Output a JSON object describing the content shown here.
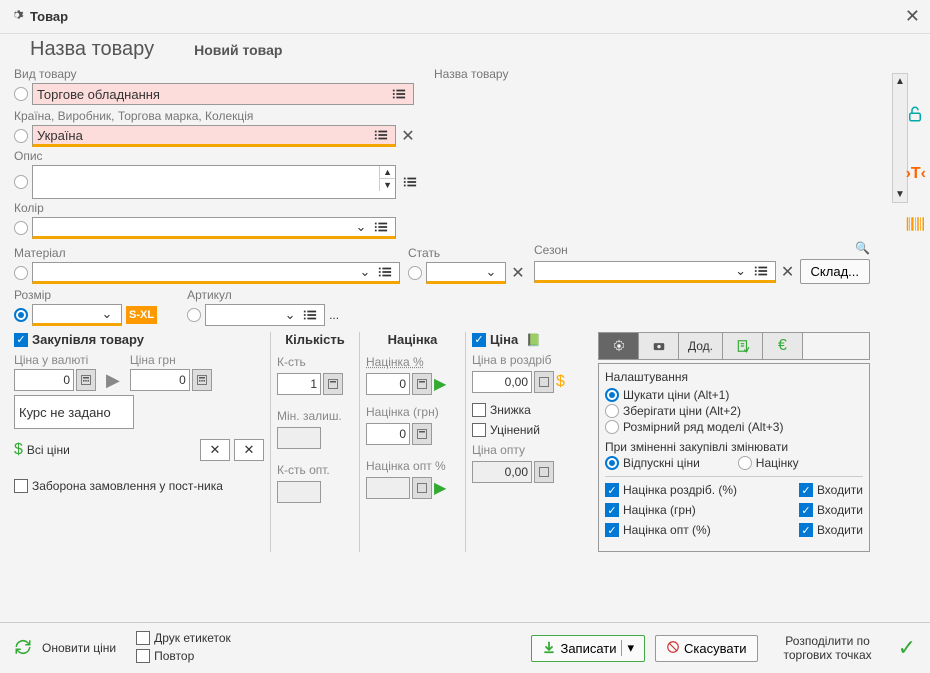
{
  "window": {
    "title": "Товар"
  },
  "header": {
    "name_label": "Назва товару",
    "new_label": "Новий товар"
  },
  "fields": {
    "type_label": "Вид товару",
    "type_value": "Торгове обладнання",
    "name2_label": "Назва товару",
    "country_label": "Країна, Виробник, Торгова марка, Колекція",
    "country_value": "Україна",
    "desc_label": "Опис",
    "color_label": "Колір",
    "material_label": "Матеріал",
    "gender_label": "Стать",
    "season_label": "Сезон",
    "warehouse_btn": "Склад...",
    "size_label": "Розмір",
    "sxl": "S-XL",
    "article_label": "Артикул",
    "dots": "..."
  },
  "purchase": {
    "title": "Закупівля товару",
    "price_currency": "Ціна у валюті",
    "price_grn": "Ціна грн",
    "val0": "0",
    "rate_msg": "Курс не задано",
    "all_prices": "Всі ціни",
    "forbid": "Заборона замовлення у пост-ника"
  },
  "qty": {
    "title": "Кількість",
    "count": "К-сть",
    "count_val": "1",
    "min": "Мін. залиш.",
    "wholesale": "К-сть опт."
  },
  "markup": {
    "title": "Націнка",
    "pct": "Націнка %",
    "pct_val": "0",
    "grn": "Націнка (грн)",
    "grn_val": "0",
    "opt": "Націнка опт %"
  },
  "price": {
    "title": "Ціна",
    "retail": "Ціна в роздріб",
    "retail_val": "0,00",
    "discount": "Знижка",
    "reduced": "Уцінений",
    "opt": "Ціна опту",
    "opt_val": "0,00"
  },
  "settings": {
    "tab_add": "Дод.",
    "header": "Налаштування",
    "opt1": "Шукати ціни (Alt+1)",
    "opt2": "Зберігати ціни (Alt+2)",
    "opt3": "Розмірний ряд моделі (Alt+3)",
    "change_header": "При зміненні закупівлі змінювати",
    "change1": "Відпускні ціни",
    "change2": "Націнку",
    "c1": "Націнка роздріб. (%)",
    "c2": "Входити",
    "c3": "Націнка (грн)",
    "c4": "Входити",
    "c5": "Націнка опт (%)",
    "c6": "Входити"
  },
  "footer": {
    "refresh": "Оновити ціни",
    "print": "Друк етикеток",
    "repeat": "Повтор",
    "save": "Записати",
    "cancel": "Скасувати",
    "distribute": "Розподілити по торгових точках"
  }
}
